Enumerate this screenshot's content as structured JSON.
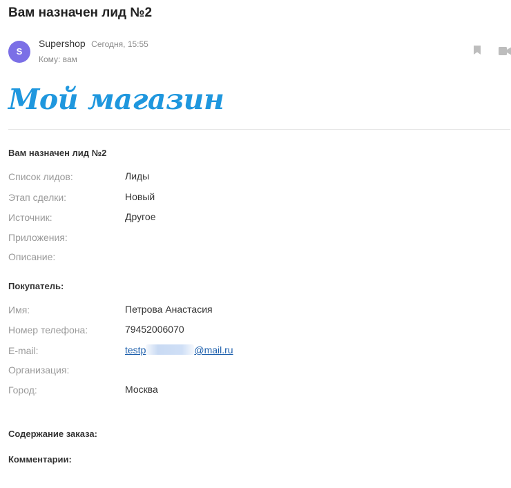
{
  "email": {
    "subject": "Вам назначен лид №2",
    "avatar_letter": "S",
    "avatar_color": "#7b6fe6",
    "sender_name": "Supershop",
    "time": "Сегодня, 15:55",
    "to_line": "Кому: вам",
    "icons": [
      "bookmark-icon",
      "video-icon"
    ]
  },
  "body": {
    "logo_text": "Мой магазин",
    "logo_color": "#1f97de",
    "lead_title": "Вам назначен лид №2",
    "lead_fields": [
      {
        "label": "Список лидов:",
        "value": "Лиды"
      },
      {
        "label": "Этап сделки:",
        "value": "Новый"
      },
      {
        "label": "Источник:",
        "value": "Другое"
      },
      {
        "label": "Приложения:",
        "value": ""
      },
      {
        "label": "Описание:",
        "value": ""
      }
    ],
    "buyer_title": "Покупатель:",
    "buyer_fields": [
      {
        "label": "Имя:",
        "value": "Петрова Анастасия"
      },
      {
        "label": "Номер телефона:",
        "value": "79452006070"
      },
      {
        "label": "E-mail:",
        "email_prefix": "testp",
        "email_suffix": "@mail.ru"
      },
      {
        "label": "Организация:",
        "value": ""
      },
      {
        "label": "Город:",
        "value": "Москва"
      }
    ],
    "order_title": "Содержание заказа:",
    "comments_title": "Комментарии:"
  }
}
